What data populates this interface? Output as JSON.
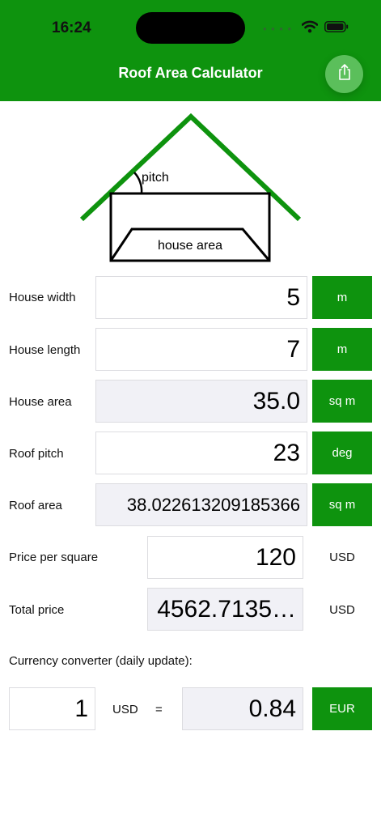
{
  "status_bar": {
    "time": "16:24"
  },
  "header": {
    "title": "Roof Area Calculator"
  },
  "diagram": {
    "pitch_label": "pitch",
    "house_area_label": "house area"
  },
  "rows": {
    "width": {
      "label": "House width",
      "value": "5",
      "unit": "m"
    },
    "length": {
      "label": "House length",
      "value": "7",
      "unit": "m"
    },
    "house_area": {
      "label": "House area",
      "value": "35.0",
      "unit": "sq m"
    },
    "pitch": {
      "label": "Roof pitch",
      "value": "23",
      "unit": "deg"
    },
    "roof_area": {
      "label": "Roof area",
      "value": "38.022613209185366",
      "unit": "sq m"
    },
    "price": {
      "label": "Price per square",
      "value": "120",
      "unit": "USD"
    },
    "total": {
      "label": "Total price",
      "value": "4562.7135…",
      "unit": "USD"
    }
  },
  "converter": {
    "title": "Currency converter (daily update):",
    "amount": "1",
    "from_currency": "USD",
    "equals": "=",
    "result": "0.84",
    "to_currency": "EUR"
  },
  "colors": {
    "accent": "#0e930e",
    "readonly_bg": "#f1f1f6"
  }
}
